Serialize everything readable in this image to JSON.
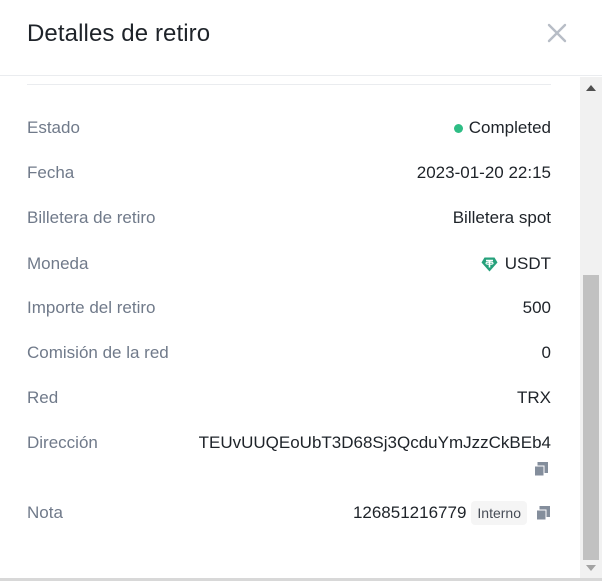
{
  "modal": {
    "title": "Detalles de retiro",
    "close_icon": "close-icon"
  },
  "details": {
    "status": {
      "label": "Estado",
      "value": "Completed",
      "color": "#2ebd85"
    },
    "date": {
      "label": "Fecha",
      "value": "2023-01-20 22:15"
    },
    "wallet": {
      "label": "Billetera de retiro",
      "value": "Billetera spot"
    },
    "coin": {
      "label": "Moneda",
      "value": "USDT",
      "icon": "usdt-icon",
      "color": "#26a17b"
    },
    "amount": {
      "label": "Importe del retiro",
      "value": "500"
    },
    "fee": {
      "label": "Comisión de la red",
      "value": "0"
    },
    "network": {
      "label": "Red",
      "value": "TRX"
    },
    "address": {
      "label": "Dirección",
      "value": "TEUvUUQEoUbT3D68Sj3QcduYmJzzCkBEb4",
      "copy_icon": "copy-icon"
    },
    "note": {
      "label": "Nota",
      "value": "126851216779",
      "badge": "Interno",
      "copy_icon": "copy-icon"
    }
  }
}
